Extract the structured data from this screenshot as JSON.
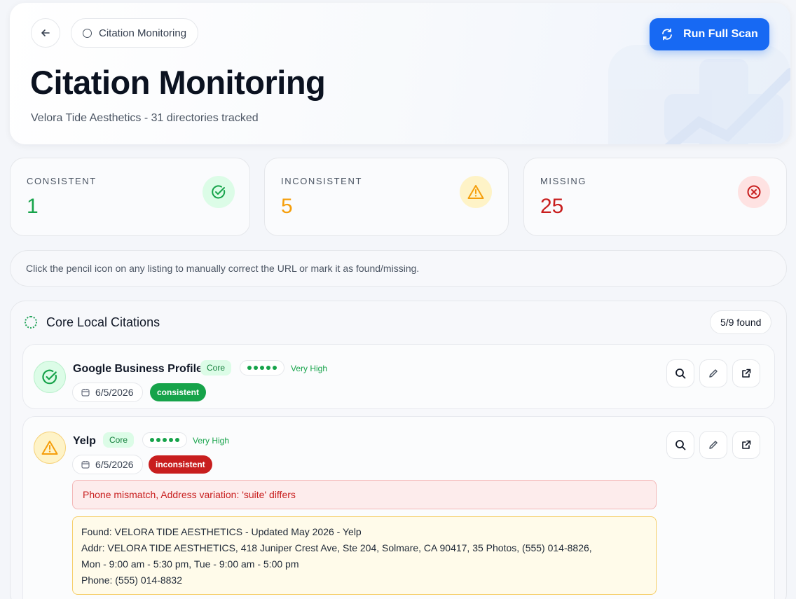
{
  "header": {
    "breadcrumb": "Citation Monitoring",
    "title": "Citation Monitoring",
    "subtitle": "Velora Tide Aesthetics - 31 directories tracked",
    "scan_label": "Run Full Scan"
  },
  "stats": [
    {
      "label": "CONSISTENT",
      "value": "1",
      "color": "#16a34a"
    },
    {
      "label": "INCONSISTENT",
      "value": "5",
      "color": "#f59e0b"
    },
    {
      "label": "MISSING",
      "value": "25",
      "color": "#c81e1e"
    }
  ],
  "hint": "Click the pencil icon on any listing to manually correct the URL or mark it as found/missing.",
  "section": {
    "title": "Core Local Citations",
    "found": "5/9 found"
  },
  "listings": [
    {
      "name": "Google Business Profile",
      "tag": "Core",
      "authority": "Very High",
      "date": "6/5/2026",
      "status": "consistent"
    },
    {
      "name": "Yelp",
      "tag": "Core",
      "authority": "Very High",
      "date": "6/5/2026",
      "status": "inconsistent",
      "issue": "Phone mismatch, Address variation: 'suite' differs",
      "found_lines": [
        "Found: VELORA TIDE AESTHETICS - Updated May 2026 - Yelp",
        "Addr: VELORA TIDE AESTHETICS, 418 Juniper Crest Ave, Ste 204, Solmare, CA 90417, 35 Photos, (555) 014-8826,",
        "Mon - 9:00 am - 5:30 pm, Tue - 9:00 am - 5:00 pm",
        "Phone: (555) 014-8832"
      ]
    }
  ],
  "colors": {
    "accent": "#1769f3",
    "consistent": "#16a34a",
    "inconsistent": "#c81e1e",
    "warning": "#f59e0b"
  }
}
